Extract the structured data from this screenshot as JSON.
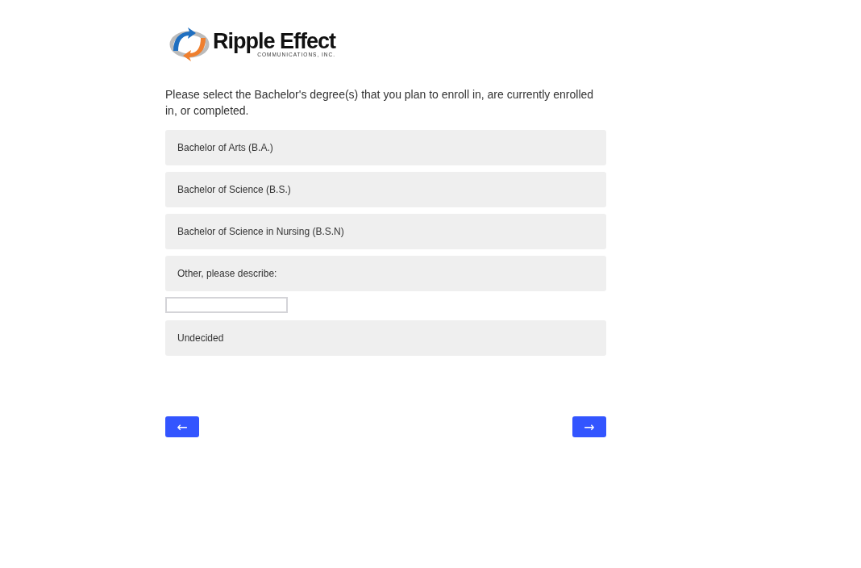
{
  "logo": {
    "name": "Ripple Effect",
    "tagline": "COMMUNICATIONS, INC."
  },
  "question": "Please select the Bachelor's degree(s) that you plan to enroll in, are currently enrolled in, or completed.",
  "choices": [
    {
      "label": "Bachelor of Arts (B.A.)",
      "selected": false
    },
    {
      "label": "Bachelor of Science (B.S.)",
      "selected": false
    },
    {
      "label": "Bachelor of Science in Nursing (B.S.N)",
      "selected": false
    },
    {
      "label": "Other, please describe:",
      "selected": false,
      "kind": "text_entry"
    },
    {
      "label": "Undecided",
      "selected": false
    }
  ],
  "navigation": {
    "back": "←",
    "next": "→"
  }
}
